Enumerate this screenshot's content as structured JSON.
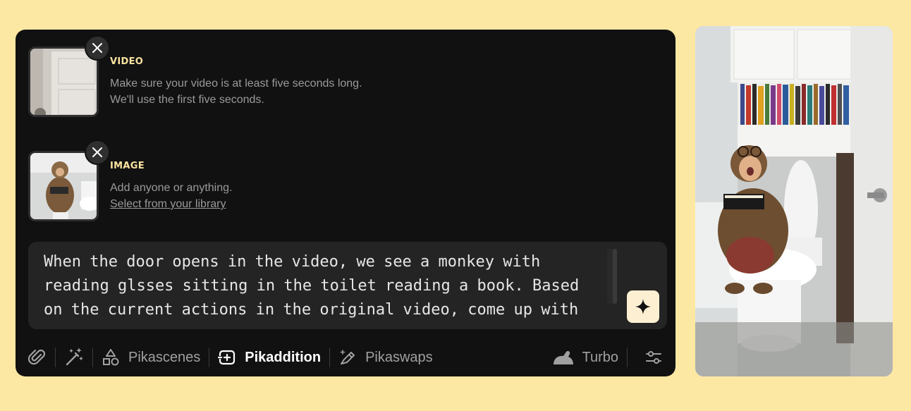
{
  "video_slot": {
    "title": "VIDEO",
    "description_line1": "Make sure your video is at least five seconds long.",
    "description_line2": "We'll use the first five seconds."
  },
  "image_slot": {
    "title": "IMAGE",
    "description": "Add anyone or anything.",
    "library_link": "Select from your library"
  },
  "prompt": {
    "text": "When the door opens in the video, we see a monkey with\nreading glsses sitting in the toilet reading a book. Based\non the current actions in the original video, come up with"
  },
  "toolbar": {
    "pikascenes_label": "Pikascenes",
    "pikaddition_label": "Pikaddition",
    "pikaswaps_label": "Pikaswaps",
    "turbo_label": "Turbo",
    "active_mode": "Pikaddition"
  },
  "icons": {
    "attach": "paperclip-icon",
    "magic": "magic-wand-icon",
    "pikascenes": "shapes-icon",
    "pikaddition": "add-frame-icon",
    "pikaswaps": "swap-brush-icon",
    "turbo": "rabbit-icon",
    "settings": "sliders-icon",
    "enhance": "sparkle-icon",
    "remove": "close-icon"
  },
  "colors": {
    "page_background": "#fde8a3",
    "panel_background": "#111111",
    "slot_title": "#fbe3a0",
    "enhance_button": "#fdf0d2"
  }
}
